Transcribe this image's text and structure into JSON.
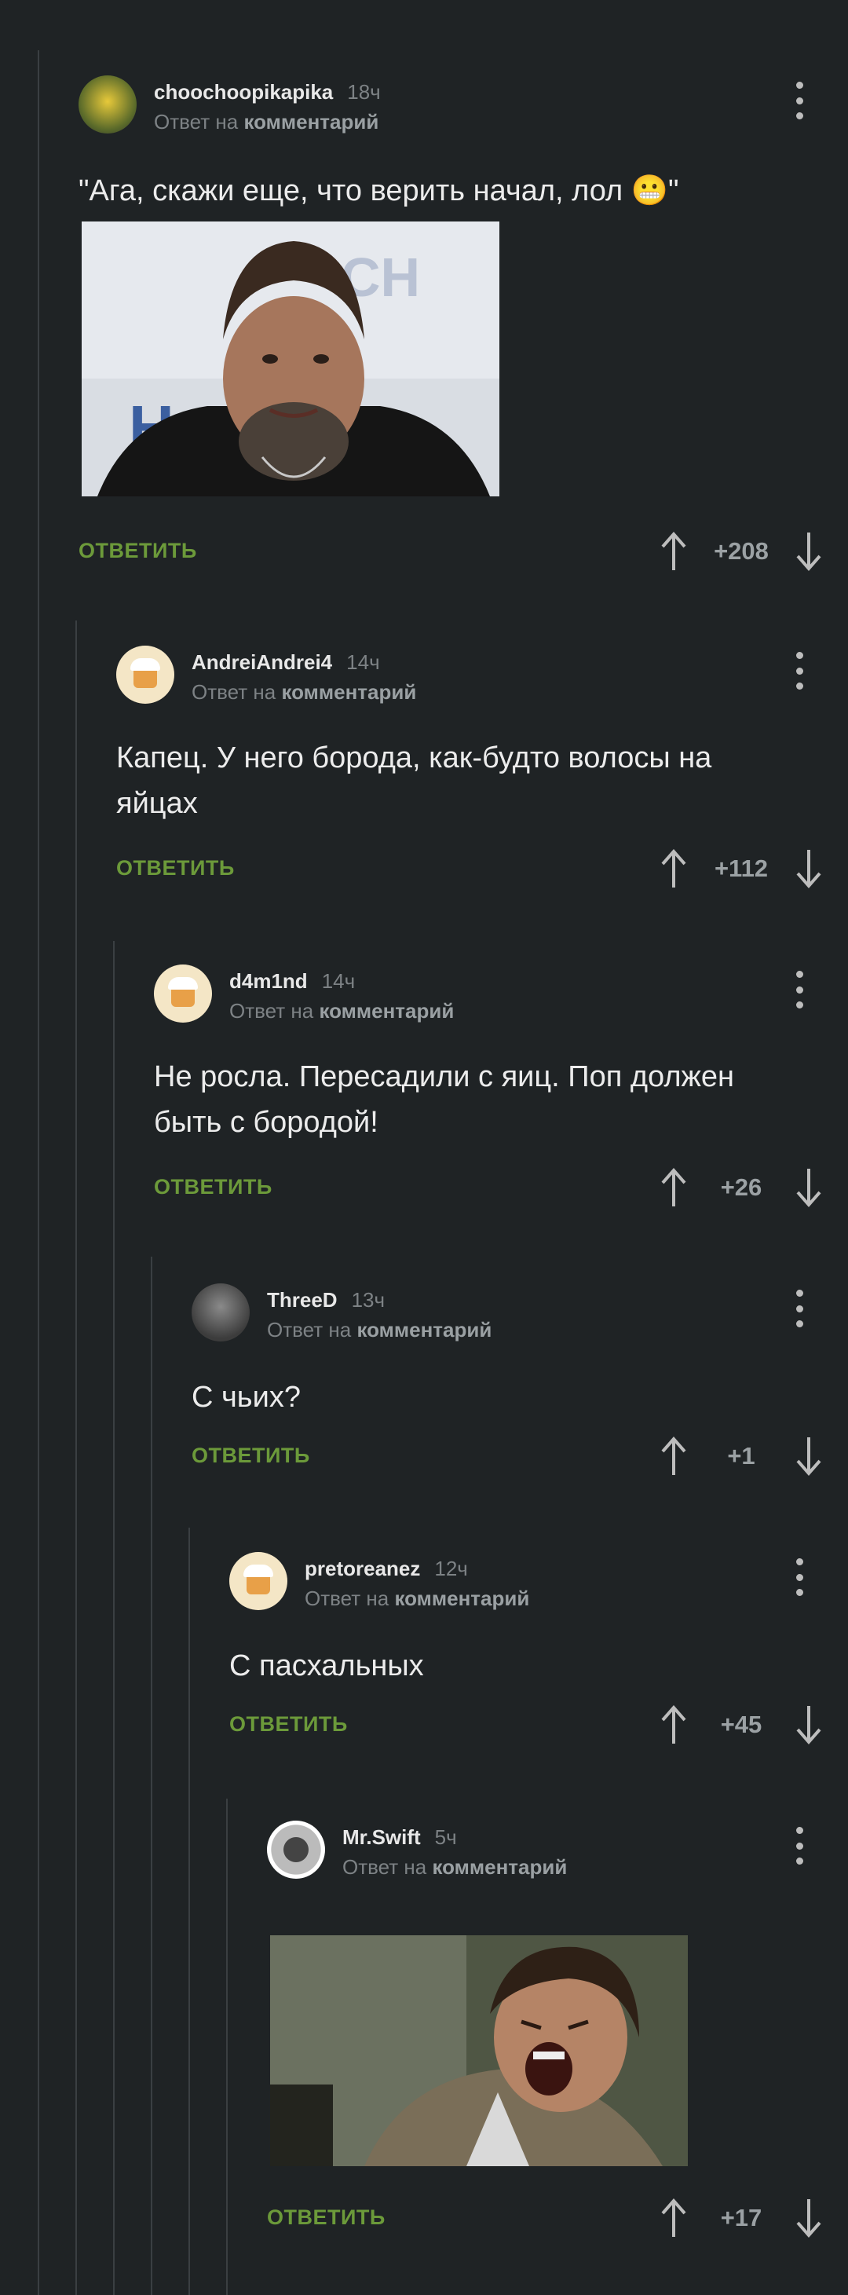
{
  "reply_label": "ОТВЕТИТЬ",
  "comments": [
    {
      "username": "choochoopikapika",
      "time": "18ч",
      "reply_prefix": "Ответ на",
      "reply_target": "комментарий",
      "text": "\"Ага, скажи еще, что верить начал, лол 😬\"",
      "score": "+208",
      "avatar": "pikachu-avatar",
      "image": "priest-photo"
    },
    {
      "username": "AndreiAndrei4",
      "time": "14ч",
      "reply_prefix": "Ответ на",
      "reply_target": "комментарий",
      "text": "Капец. У него борода, как-будто волосы на яйцах",
      "score": "+112",
      "avatar": "default-cake-avatar"
    },
    {
      "username": "d4m1nd",
      "time": "14ч",
      "reply_prefix": "Ответ на",
      "reply_target": "комментарий",
      "text": "Не росла. Пересадили с яиц. Поп должен быть с бородой!",
      "score": "+26",
      "avatar": "default-cake-avatar"
    },
    {
      "username": "ThreeD",
      "time": "13ч",
      "reply_prefix": "Ответ на",
      "reply_target": "комментарий",
      "text": "С чьих?",
      "score": "+1",
      "avatar": "photo-avatar"
    },
    {
      "username": "pretoreanez",
      "time": "12ч",
      "reply_prefix": "Ответ на",
      "reply_target": "комментарий",
      "text": "С пасхальных",
      "score": "+45",
      "avatar": "default-cake-avatar"
    },
    {
      "username": "Mr.Swift",
      "time": "5ч",
      "reply_prefix": "Ответ на",
      "reply_target": "комментарий",
      "text": "",
      "score": "+17",
      "avatar": "ball-avatar",
      "image": "laughing-man-photo"
    }
  ],
  "colors": {
    "background": "#1f2325",
    "reply_link": "#6c9a3a",
    "thread_line": "#3a3f42"
  }
}
